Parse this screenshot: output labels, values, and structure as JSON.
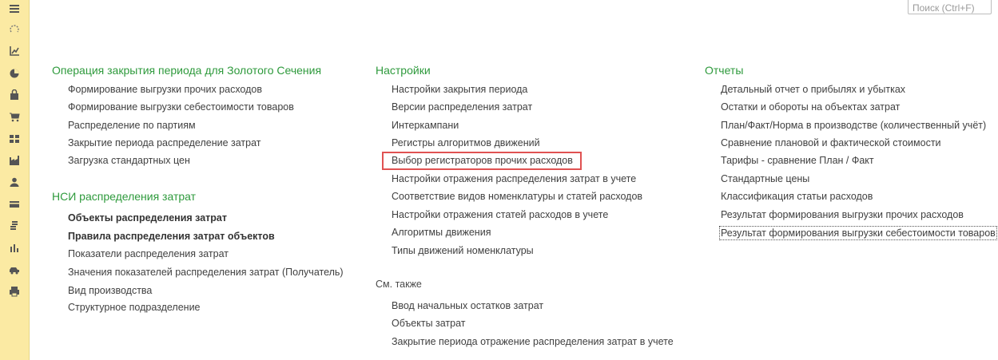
{
  "search": {
    "placeholder": "Поиск (Ctrl+F)"
  },
  "sidebar": {
    "icons": [
      "menu-icon",
      "history-icon",
      "chart-flow-icon",
      "pie-chart-icon",
      "bag-icon",
      "cart-icon",
      "grid-icon",
      "factory-icon",
      "person-icon",
      "card-icon",
      "coins-icon",
      "bar-chart-icon",
      "car-icon",
      "printer-icon"
    ]
  },
  "sections": {
    "closing": {
      "title": "Операция закрытия периода для Золотого Сечения",
      "items": [
        "Формирование выгрузки прочих расходов",
        "Формирование выгрузки себестоимости товаров",
        "Распределение по партиям",
        "Закрытие периода распределение затрат",
        "Загрузка стандартных цен"
      ]
    },
    "nsi": {
      "title": "НСИ распределения затрат",
      "items": [
        "Объекты распределения затрат",
        "Правила распределения затрат объектов",
        "Показатели распределения затрат",
        "Значения показателей распределения затрат (Получатель)",
        "Вид производства",
        "Структурное подразделение"
      ]
    },
    "settings": {
      "title": "Настройки",
      "items": [
        "Настройки закрытия периода",
        "Версии распределения затрат",
        "Интеркампани",
        "Регистры алгоритмов движений",
        "Выбор регистраторов прочих расходов",
        "Настройки отражения распределения затрат в учете",
        "Соответствие видов номенклатуры и статей расходов",
        "Настройки отражения статей расходов в учете",
        "Алгоритмы движения",
        "Типы движений номенклатуры"
      ]
    },
    "see_also": {
      "title": "См. также",
      "items": [
        "Ввод начальных остатков затрат",
        "Объекты затрат",
        "Закрытие периода отражение распределения затрат в учете"
      ]
    },
    "reports": {
      "title": "Отчеты",
      "items": [
        "Детальный отчет о прибылях и убытках",
        "Остатки и обороты на объектах затрат",
        "План/Факт/Норма в производстве (количественный учёт)",
        "Сравнение плановой и фактической стоимости",
        "Тарифы - сравнение План / Факт",
        "Стандартные цены",
        "Классификация статьи расходов",
        "Результат формирования выгрузки прочих расходов",
        "Результат формирования выгрузки себестоимости товаров"
      ]
    }
  },
  "colors": {
    "section_title": "#2e9a3c",
    "sidebar_bg": "#fbeaa3",
    "highlight_border": "#e05252"
  }
}
